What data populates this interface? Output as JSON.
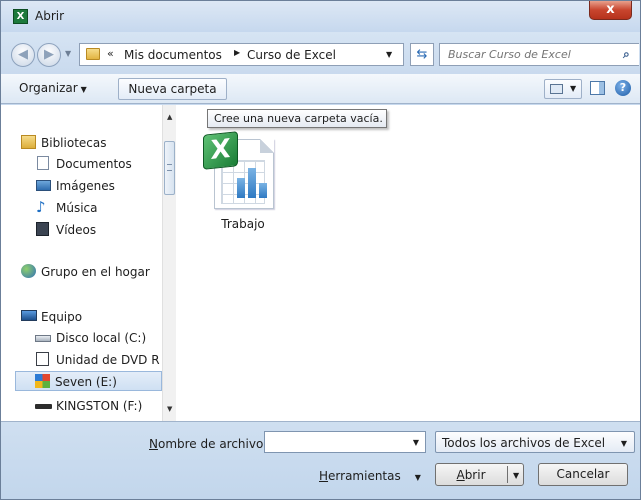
{
  "window": {
    "title": "Abrir",
    "close_label": "x"
  },
  "nav": {
    "back_glyph": "◀",
    "forward_glyph": "▶",
    "address": {
      "chevron": "«",
      "crumbs": [
        "Mis documentos",
        "Curso de Excel"
      ],
      "separator": "▶"
    },
    "refresh_glyph": "⇆",
    "search_placeholder": "Buscar Curso de Excel"
  },
  "toolbar": {
    "organize_label": "Organizar",
    "new_folder_label": "Nueva carpeta",
    "help_glyph": "?"
  },
  "tooltip": "Cree una nueva carpeta vacía.",
  "sidebar": {
    "items": [
      {
        "label": "Bibliotecas",
        "icon": "library-icon"
      },
      {
        "label": "Documentos",
        "icon": "documents-icon"
      },
      {
        "label": "Imágenes",
        "icon": "pictures-icon"
      },
      {
        "label": "Música",
        "icon": "music-icon"
      },
      {
        "label": "Vídeos",
        "icon": "videos-icon"
      },
      {
        "label": "Grupo en el hogar",
        "icon": "homegroup-icon"
      },
      {
        "label": "Equipo",
        "icon": "computer-icon"
      },
      {
        "label": "Disco local (C:)",
        "icon": "drive-icon"
      },
      {
        "label": "Unidad de DVD R",
        "icon": "dvd-drive-icon"
      },
      {
        "label": "Seven (E:)",
        "icon": "windows-drive-icon",
        "selected": true
      },
      {
        "label": "KINGSTON (F:)",
        "icon": "usb-drive-icon"
      }
    ]
  },
  "files": [
    {
      "name": "Trabajo",
      "icon": "excel-file-icon",
      "logo_letter": "X"
    }
  ],
  "bottom": {
    "filename_label_accel": "N",
    "filename_label_rest": "ombre de archivo:",
    "filename_value": "",
    "filter_label": "Todos los archivos de Excel",
    "tools_label_accel": "H",
    "tools_label_rest": "erramientas",
    "open_label_accel": "A",
    "open_label_rest": "brir",
    "cancel_label": "Cancelar"
  }
}
